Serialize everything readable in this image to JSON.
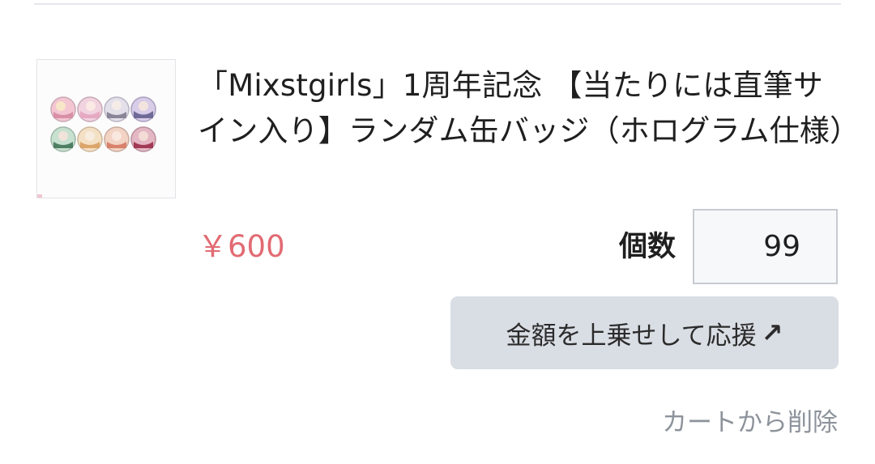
{
  "item": {
    "title": "「Mixstgirls」1周年記念 【当たりには直筆サイン入り】ランダム缶バッジ（ホログラム仕様）",
    "price": "￥600",
    "quantity_label": "個数",
    "quantity_value": "99",
    "support_button_label": "金額を上乗せして応援",
    "support_button_icon": "arrow-up-right-icon",
    "remove_label": "カートから削除"
  },
  "colors": {
    "price": "#e26b73",
    "button_bg": "#d9dde4",
    "link": "#8d939b"
  }
}
